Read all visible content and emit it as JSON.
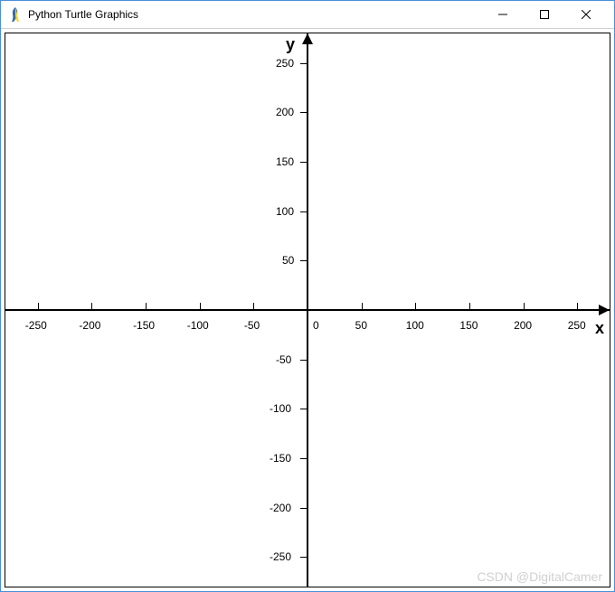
{
  "window": {
    "title": "Python Turtle Graphics"
  },
  "chart_data": {
    "type": "scatter",
    "title": "",
    "xlabel": "x",
    "ylabel": "y",
    "origin_label": "0",
    "xlim": [
      -280,
      280
    ],
    "ylim": [
      -280,
      280
    ],
    "x_ticks": [
      -250,
      -200,
      -150,
      -100,
      -50,
      50,
      100,
      150,
      200,
      250
    ],
    "y_ticks": [
      -250,
      -200,
      -150,
      -100,
      -50,
      50,
      100,
      150,
      200,
      250
    ],
    "series": []
  },
  "watermark": "CSDN @DigitalCamer"
}
